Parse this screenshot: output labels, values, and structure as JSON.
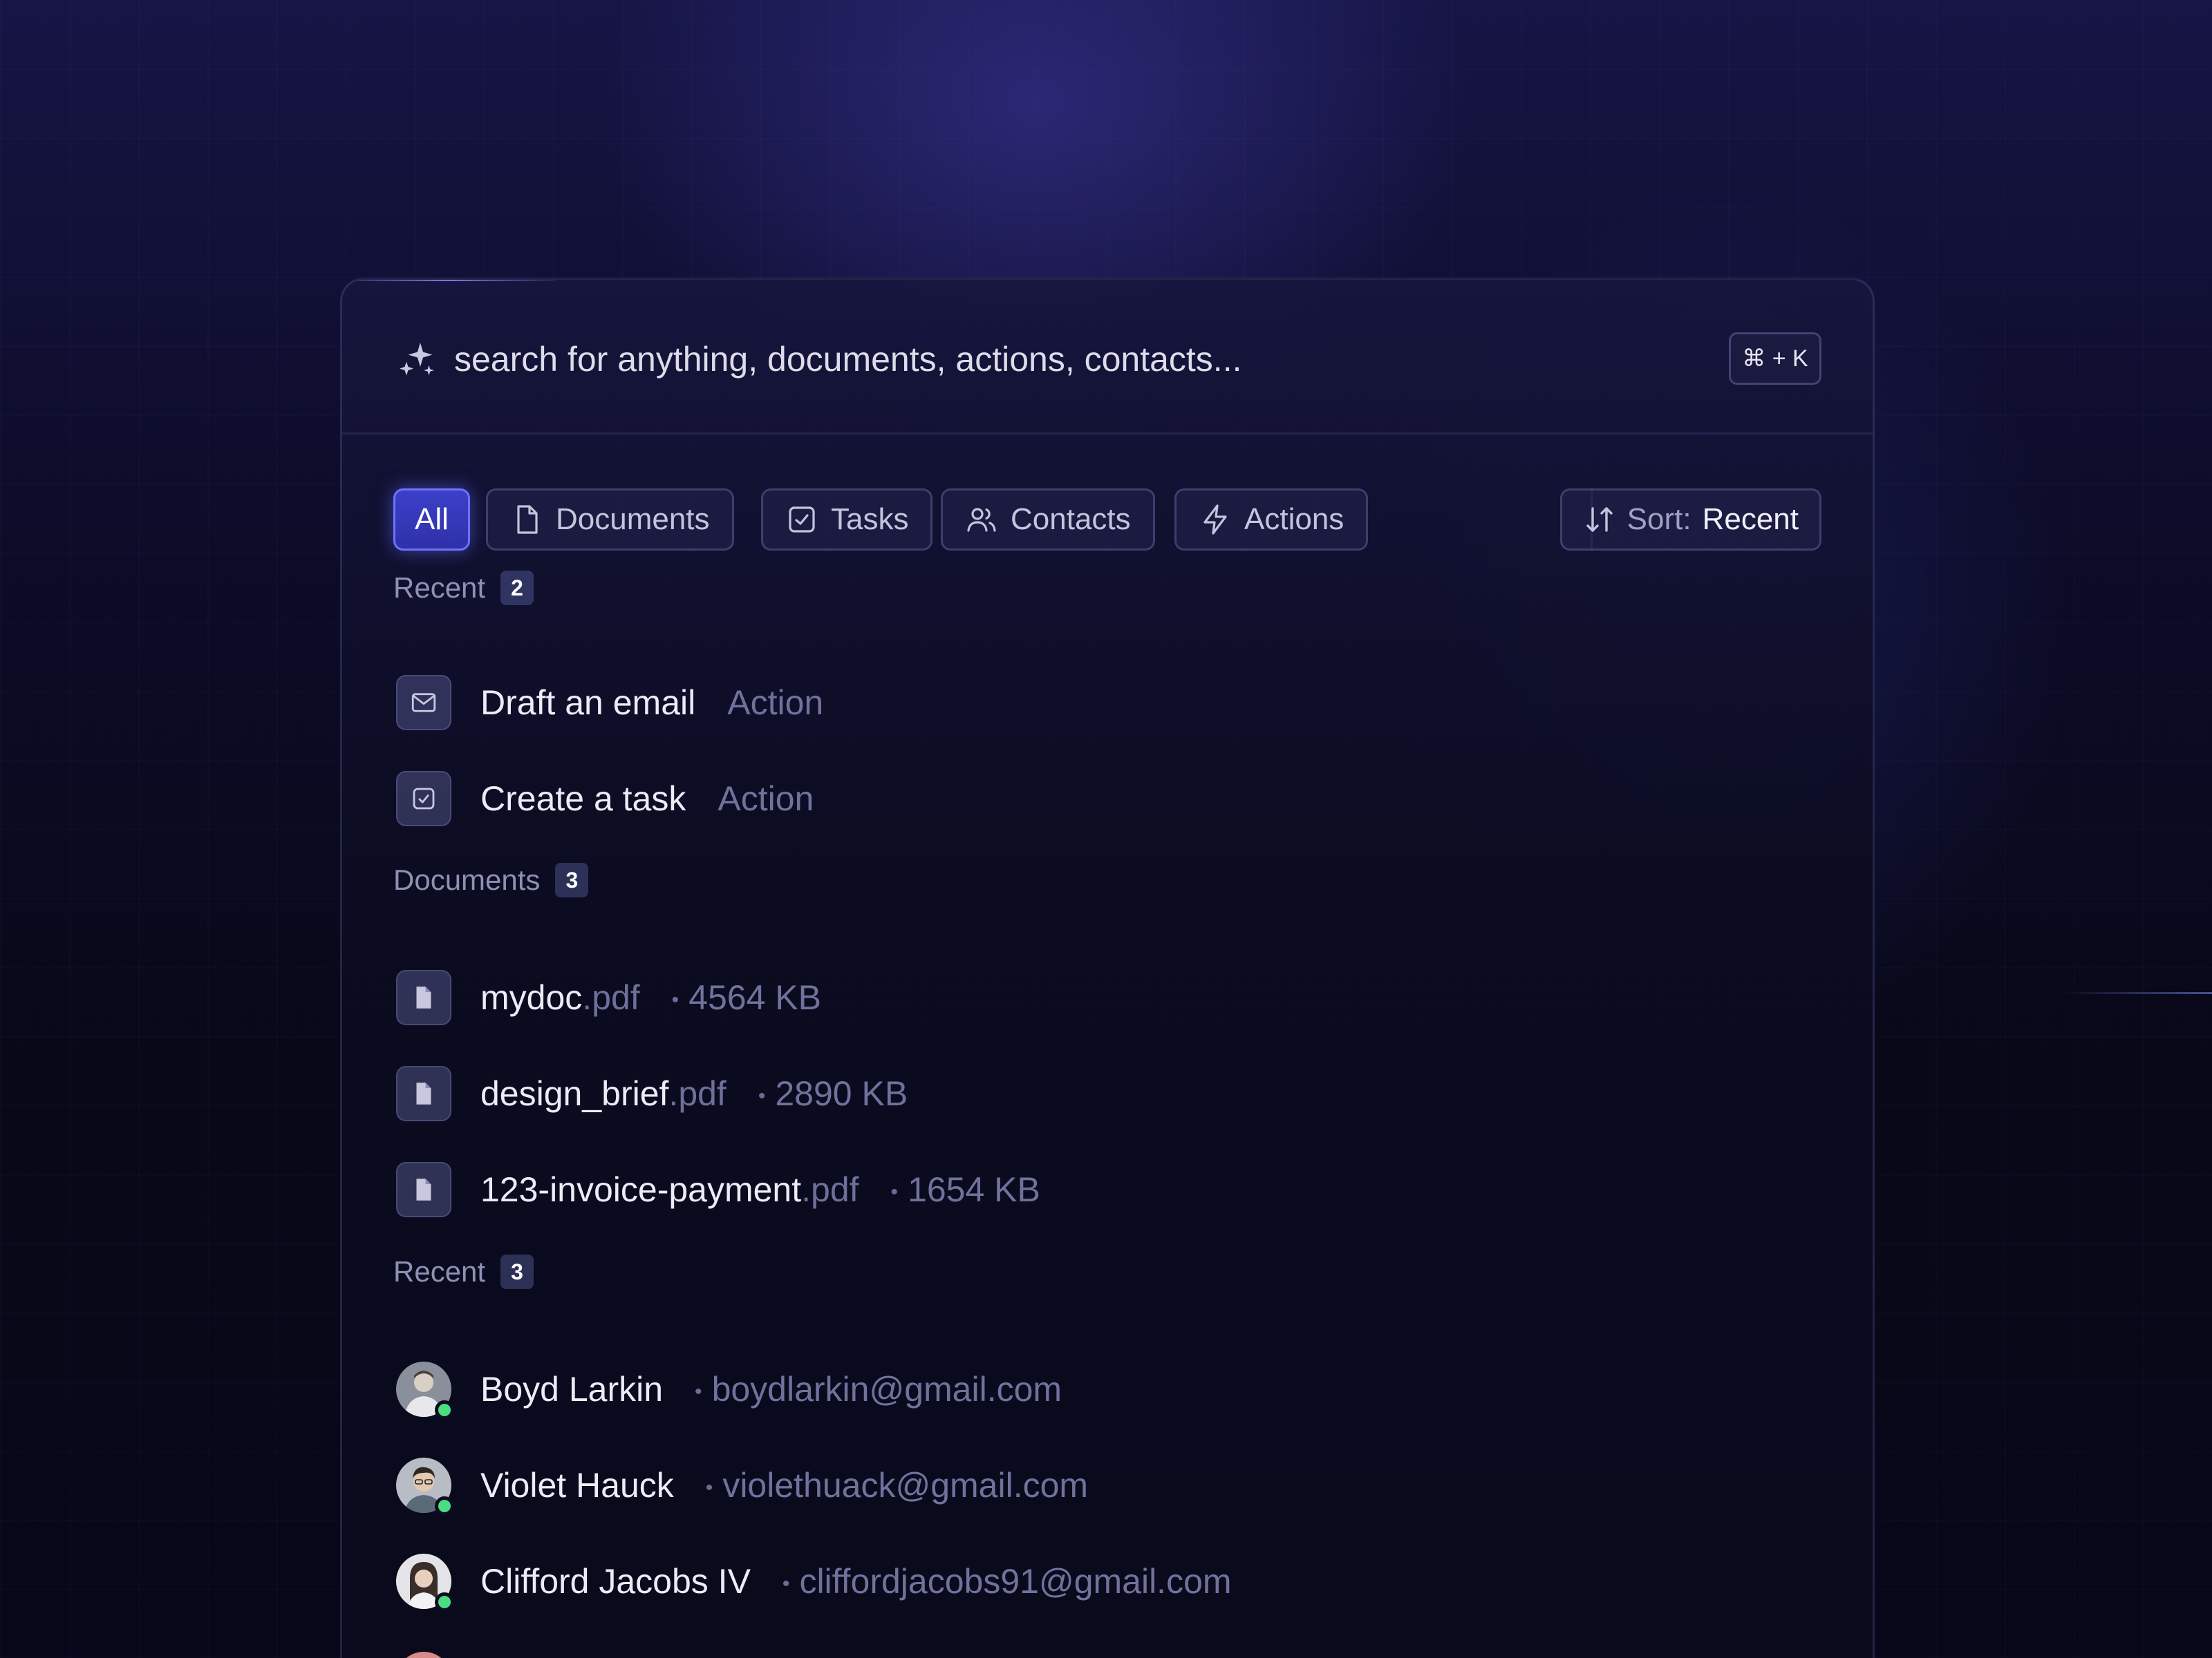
{
  "search": {
    "placeholder": "search for anything, documents, actions, contacts...",
    "shortcut": "⌘ + K"
  },
  "filters": {
    "chips": [
      {
        "label": "All",
        "icon": "none",
        "active": true
      },
      {
        "label": "Documents",
        "icon": "file-icon",
        "active": false
      },
      {
        "label": "Tasks",
        "icon": "checkbox-icon",
        "active": false
      },
      {
        "label": "Contacts",
        "icon": "users-icon",
        "active": false
      },
      {
        "label": "Actions",
        "icon": "lightning-icon",
        "active": false
      }
    ],
    "sort_label": "Sort:",
    "sort_value": "Recent"
  },
  "sections": {
    "recent_actions": {
      "title": "Recent",
      "count": "2",
      "items": [
        {
          "title": "Draft an email",
          "meta": "Action",
          "icon": "mail-icon"
        },
        {
          "title": "Create a task",
          "meta": "Action",
          "icon": "checkbox-icon"
        }
      ]
    },
    "documents": {
      "title": "Documents",
      "count": "3",
      "items": [
        {
          "name": "mydoc",
          "ext": ".pdf",
          "size": "4564 KB",
          "icon": "document-icon"
        },
        {
          "name": "design_brief",
          "ext": ".pdf",
          "size": "2890 KB",
          "icon": "document-icon"
        },
        {
          "name": "123-invoice-payment",
          "ext": ".pdf",
          "size": "1654 KB",
          "icon": "document-icon"
        }
      ]
    },
    "recent_contacts": {
      "title": "Recent",
      "count": "3",
      "items": [
        {
          "name": "Boyd Larkin",
          "email": "boydlarkin@gmail.com",
          "status": "online"
        },
        {
          "name": "Violet Hauck",
          "email": "violethuack@gmail.com",
          "status": "online"
        },
        {
          "name": "Clifford Jacobs IV",
          "email": "cliffordjacobs91@gmail.com",
          "status": "online"
        }
      ]
    }
  },
  "colors": {
    "accent": "#3c40c8",
    "online": "#4ade80"
  }
}
